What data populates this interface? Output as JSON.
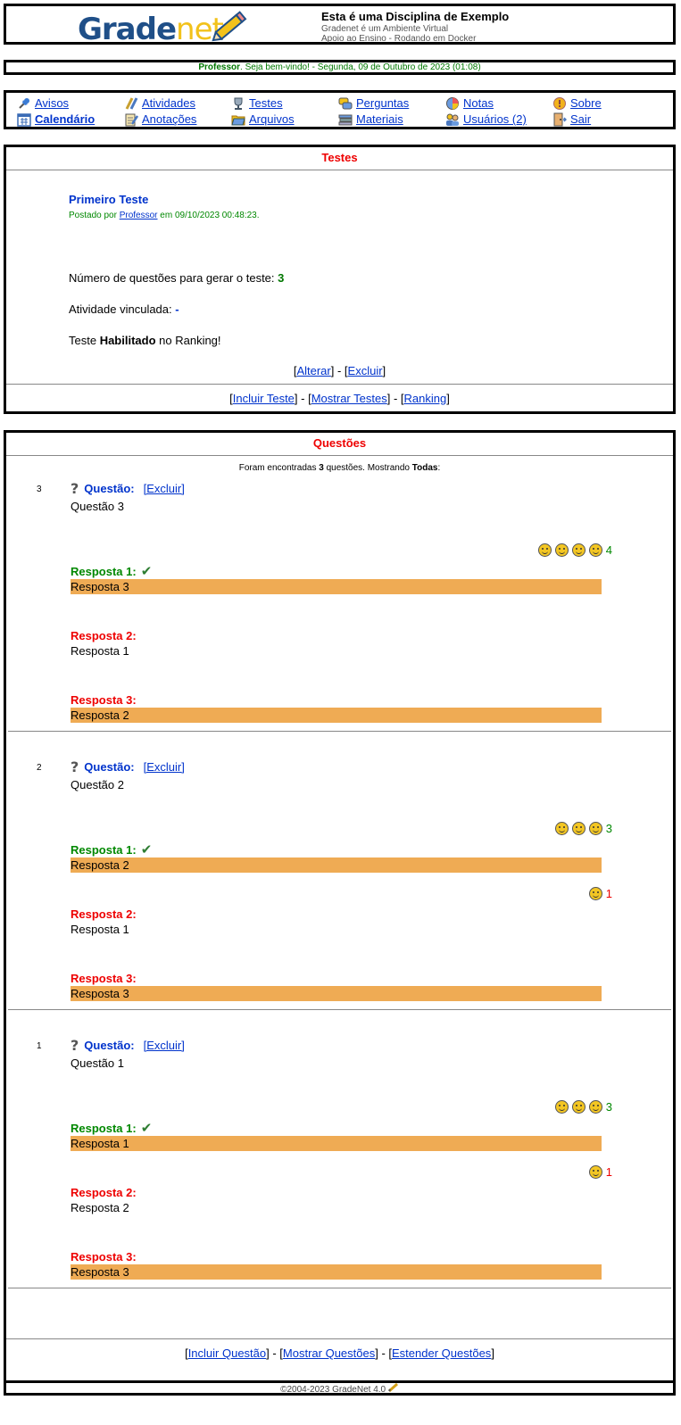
{
  "header": {
    "logo": {
      "part1": "Grade",
      "part2": "net"
    },
    "course_title": "Esta é uma Disciplina de Exemplo",
    "subtitle1": "Gradenet é um Ambiente Virtual",
    "subtitle2": "Apoio ao Ensino - Rodando em Docker"
  },
  "welcome": {
    "user": "Professor",
    "message": ". Seja bem-vindo! - Segunda, 09 de Outubro de 2023 (01:08)"
  },
  "menu": [
    {
      "label": "Avisos",
      "icon": "pin-icon"
    },
    {
      "label": "Atividades",
      "icon": "pencils-icon"
    },
    {
      "label": "Testes",
      "icon": "trophy-icon"
    },
    {
      "label": "Perguntas",
      "icon": "chat-icon"
    },
    {
      "label": "Notas",
      "icon": "pie-chart-icon"
    },
    {
      "label": "Sobre",
      "icon": "info-icon"
    },
    {
      "label": "Calendário",
      "icon": "calendar-icon"
    },
    {
      "label": "Anotações",
      "icon": "notepad-icon"
    },
    {
      "label": "Arquivos",
      "icon": "folder-icon"
    },
    {
      "label": "Materiais",
      "icon": "books-icon"
    },
    {
      "label": "Usuários (2)",
      "icon": "users-icon"
    },
    {
      "label": "Sair",
      "icon": "exit-door-icon"
    }
  ],
  "testes": {
    "title": "Testes",
    "test_name": "Primeiro Teste",
    "posted_prefix": "Postado por ",
    "posted_by": "Professor",
    "posted_suffix": " em 09/10/2023 00:48:23.",
    "num_questions_label": "Número de questões para gerar o teste: ",
    "num_questions": "3",
    "activity_label": "Atividade vinculada: ",
    "activity_value": "-",
    "ranking_prefix": "Teste ",
    "ranking_status": "Habilitado",
    "ranking_suffix": " no Ranking!",
    "alterar": "Alterar",
    "excluir": "Excluir",
    "incluir_teste": "Incluir Teste",
    "mostrar_testes": "Mostrar Testes",
    "ranking": "Ranking"
  },
  "questoes": {
    "title": "Questões",
    "found_prefix": "Foram encontradas ",
    "found_count": "3",
    "found_middle": " questões. Mostrando ",
    "found_filter": "Todas",
    "found_suffix": ":",
    "question_word": "Questão:",
    "excluir": "[Excluir]",
    "items": [
      {
        "num": "3",
        "text": "Questão 3",
        "answers": [
          {
            "label": "Resposta 1:",
            "text": "Resposta 3",
            "votes": "4"
          },
          {
            "label": "Resposta 2:",
            "text": "Resposta 1",
            "votes": ""
          },
          {
            "label": "Resposta 3:",
            "text": "Resposta 2",
            "votes": ""
          }
        ]
      },
      {
        "num": "2",
        "text": "Questão 2",
        "answers": [
          {
            "label": "Resposta 1:",
            "text": "Resposta 2",
            "votes": "3"
          },
          {
            "label": "Resposta 2:",
            "text": "Resposta 1",
            "votes": "1"
          },
          {
            "label": "Resposta 3:",
            "text": "Resposta 3",
            "votes": ""
          }
        ]
      },
      {
        "num": "1",
        "text": "Questão 1",
        "answers": [
          {
            "label": "Resposta 1:",
            "text": "Resposta 1",
            "votes": "3"
          },
          {
            "label": "Resposta 2:",
            "text": "Resposta 2",
            "votes": "1"
          },
          {
            "label": "Resposta 3:",
            "text": "Resposta 3",
            "votes": ""
          }
        ]
      }
    ],
    "incluir_questao": "Incluir Questão",
    "mostrar_questoes": "Mostrar Questões",
    "estender_questoes": "Estender Questões"
  },
  "footer": {
    "text": "©2004-2023 GradeNet 4.0"
  },
  "colors": {
    "highlight": "#efab54",
    "correct": "#008800",
    "wrong": "#ee0000",
    "link": "#0033cc"
  }
}
